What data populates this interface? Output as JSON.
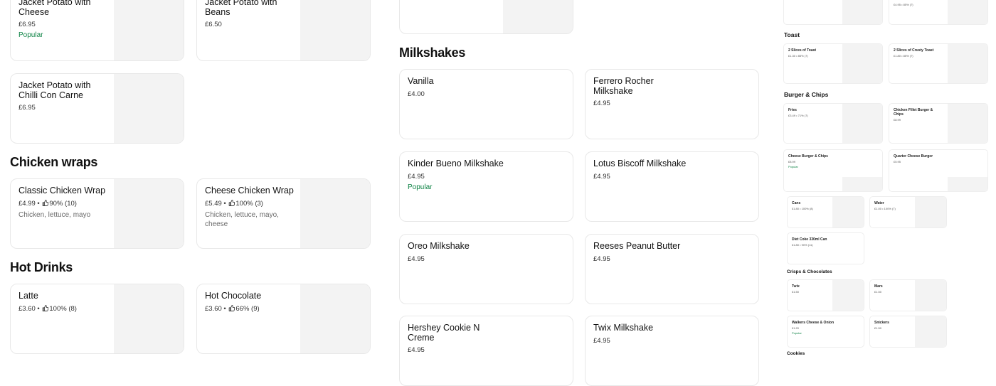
{
  "col1": {
    "sections": {
      "chicken_wraps": "Chicken wraps",
      "hot_drinks": "Hot Drinks"
    },
    "jacket_cheese": {
      "name": "Jacket Potato with Cheese",
      "price": "£6.95",
      "badge": "Popular"
    },
    "jacket_beans": {
      "name": "Jacket Potato with Beans",
      "price": "£6.50"
    },
    "jacket_chilli": {
      "name": "Jacket Potato with Chilli Con Carne",
      "price": "£6.95"
    },
    "classic_wrap": {
      "name": "Classic Chicken Wrap",
      "price": "£4.99",
      "rating": "90% (10)",
      "desc": "Chicken, lettuce, mayo"
    },
    "cheese_wrap": {
      "name": "Cheese Chicken Wrap",
      "price": "£5.49",
      "rating": "100% (3)",
      "desc": "Chicken, lettuce, mayo, cheese"
    },
    "latte": {
      "name": "Latte",
      "price": "£3.60",
      "rating": "100% (8)"
    },
    "hot_choc": {
      "name": "Hot Chocolate",
      "price": "£3.60",
      "rating": "66% (9)"
    }
  },
  "col2": {
    "section": "Milkshakes",
    "items": [
      {
        "name": "Vanilla",
        "price": "£4.00"
      },
      {
        "name": "Ferrero Rocher Milkshake",
        "price": "£4.95"
      },
      {
        "name": "Kinder Bueno Milkshake",
        "price": "£4.95",
        "badge": "Popular"
      },
      {
        "name": "Lotus Biscoff Milkshake",
        "price": "£4.95"
      },
      {
        "name": "Oreo Milkshake",
        "price": "£4.95"
      },
      {
        "name": "Reeses Peanut Butter",
        "price": "£4.95"
      },
      {
        "name": "Hershey Cookie N Creme",
        "price": "£4.95"
      },
      {
        "name": "Twix Milkshake",
        "price": "£4.95"
      }
    ]
  },
  "col3": {
    "top_right_meta": "£4.95 • 85% (7)",
    "toast": {
      "section": "Toast",
      "a": {
        "name": "2 Slices of Toast",
        "meta": "£1.30 • 85% (7)"
      },
      "b": {
        "name": "2 Slices of Crusty Toast",
        "meta": "£1.80 • 85% (7)"
      }
    },
    "burger": {
      "section": "Burger & Chips",
      "fries": {
        "name": "Fries",
        "meta": "£3.49 • 71% (7)"
      },
      "fillet": {
        "name": "Chicken Fillet Burger & Chips",
        "meta": "£8.99"
      },
      "cheese": {
        "name": "Cheese Burger & Chips",
        "meta": "£8.99",
        "badge": "Popular"
      },
      "quarter": {
        "name": "Quarter Cheese Burger",
        "meta": "£5.95"
      }
    },
    "drinks": {
      "cans": {
        "name": "Cans",
        "meta": "£1.80 • 100% (8)"
      },
      "water": {
        "name": "Water",
        "meta": "£1.00 • 100% (7)"
      },
      "diet": {
        "name": "Diet Coke 330ml Can",
        "meta": "£1.80 • 90% (11)"
      }
    },
    "crisps": {
      "section": "Crisps & Chocolates",
      "twix": {
        "name": "Twix",
        "meta": "£1.50"
      },
      "mars": {
        "name": "Mars",
        "meta": "£1.50"
      },
      "walkers": {
        "name": "Walkers Cheese & Onion",
        "meta": "£1.20",
        "badge": "Popular"
      },
      "snickers": {
        "name": "Snickers",
        "meta": "£1.50"
      }
    },
    "next_section": "Cookies"
  },
  "colors": {
    "popular": "#0e8345",
    "border": "#e8e8e8",
    "thumb": "#f3f3f3"
  },
  "icons": {
    "rating": "thumbs-up-icon"
  }
}
